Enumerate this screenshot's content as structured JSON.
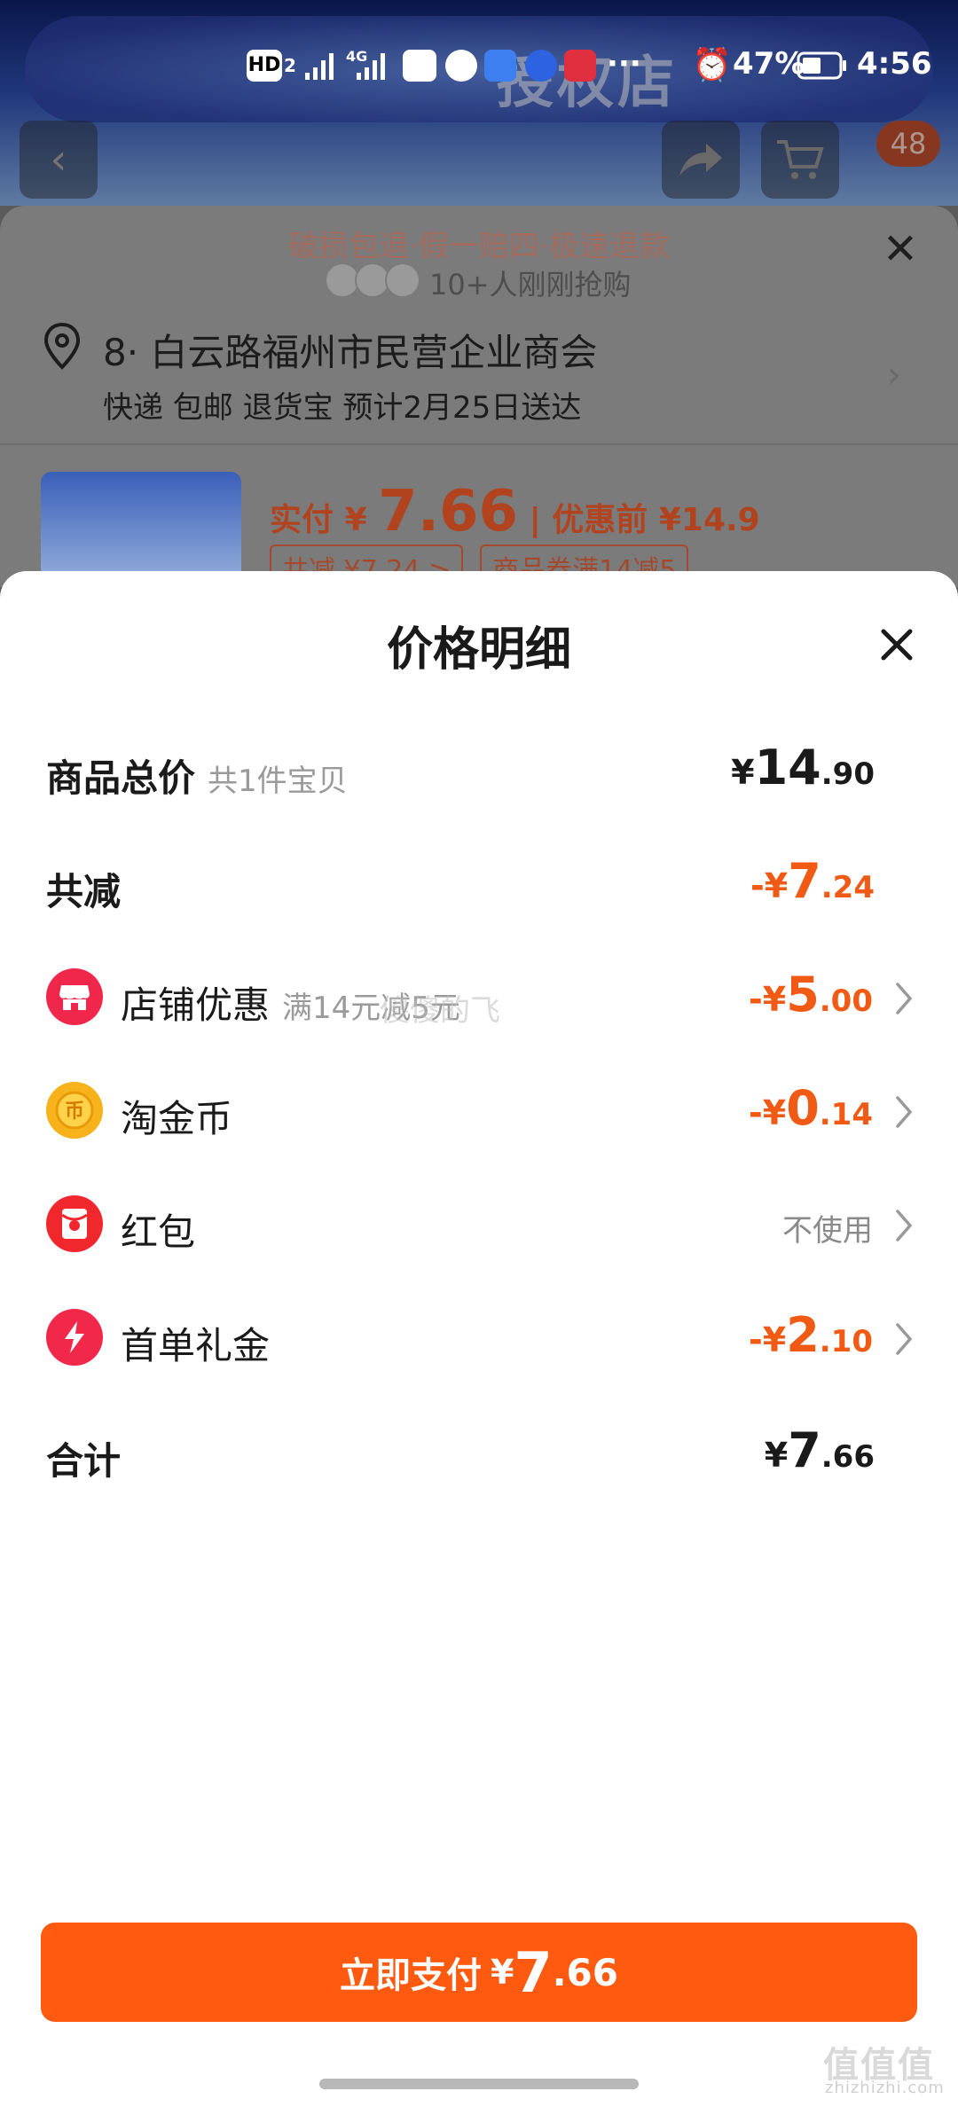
{
  "status_bar": {
    "network_hd": "HD",
    "network_slot": "2",
    "network_gen": "4G",
    "battery_percent": "47%",
    "time": "4:56",
    "more": "···"
  },
  "background_page": {
    "banner_text": "授权店",
    "cart_badge": "48",
    "guarantee": "破损包退·假一赔四·极速退款",
    "buyers": "10+人刚刚抢购",
    "address": "8· 白云路福州市民营企业商会",
    "delivery": "快递 包邮 退货宝 预计2月25日送达",
    "price_label": "实付",
    "price_symbol": "¥",
    "price_value": "7.66",
    "price_before": "| 优惠前 ¥14.9",
    "tag_discount": "共减 ¥7.24 >",
    "tag_coupon": "商品券满14减5"
  },
  "price_detail": {
    "title": "价格明细",
    "total": {
      "label": "商品总价",
      "sub": "共1件宝贝",
      "prefix": "¥",
      "int": "14",
      "dec": ".90"
    },
    "reduction": {
      "label": "共减",
      "prefix": "-¥",
      "int": "7",
      "dec": ".24"
    },
    "items": [
      {
        "label": "店铺优惠",
        "sub": "满14元减5元",
        "prefix": "-¥",
        "int": "5",
        "dec": ".00",
        "icon": "shop-icon"
      },
      {
        "label": "淘金币",
        "sub": "",
        "prefix": "-¥",
        "int": "0",
        "dec": ".14",
        "icon": "coin-icon"
      },
      {
        "label": "红包",
        "sub": "",
        "value": "不使用",
        "icon": "red-packet-icon"
      },
      {
        "label": "首单礼金",
        "sub": "",
        "prefix": "-¥",
        "int": "2",
        "dec": ".10",
        "icon": "lightning-icon"
      }
    ],
    "sum": {
      "label": "合计",
      "prefix": "¥",
      "int": "7",
      "dec": ".66"
    },
    "watermark": "傻傻的飞"
  },
  "pay_button": {
    "label": "立即支付",
    "prefix": "¥",
    "int": "7",
    "dec": ".66"
  },
  "corner_watermark": {
    "main": "值值值",
    "sub": "zhizhizhi.com"
  },
  "colors": {
    "accent": "#ff5a0f",
    "discount": "#f05a14",
    "text": "#1a1a1a",
    "muted": "#9a9a9a"
  }
}
